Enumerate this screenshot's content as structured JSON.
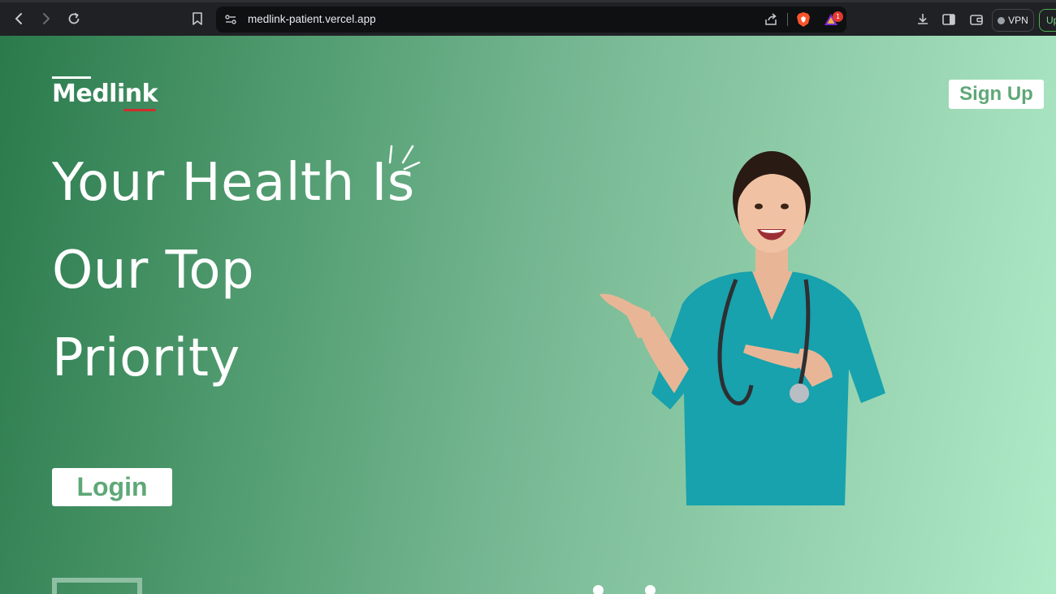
{
  "browser": {
    "url": "medlink-patient.vercel.app",
    "notifications_badge": "1",
    "vpn_label": "VPN",
    "update_label": "Up"
  },
  "header": {
    "logo_text": "Medlink",
    "signup_label": "Sign Up"
  },
  "hero": {
    "headline_line1": "Your Health Is",
    "headline_line2": "Our Top",
    "headline_line3": "Priority",
    "login_label": "Login"
  },
  "colors": {
    "accent_green": "#5ea877",
    "logo_underline": "#d12e2e"
  }
}
